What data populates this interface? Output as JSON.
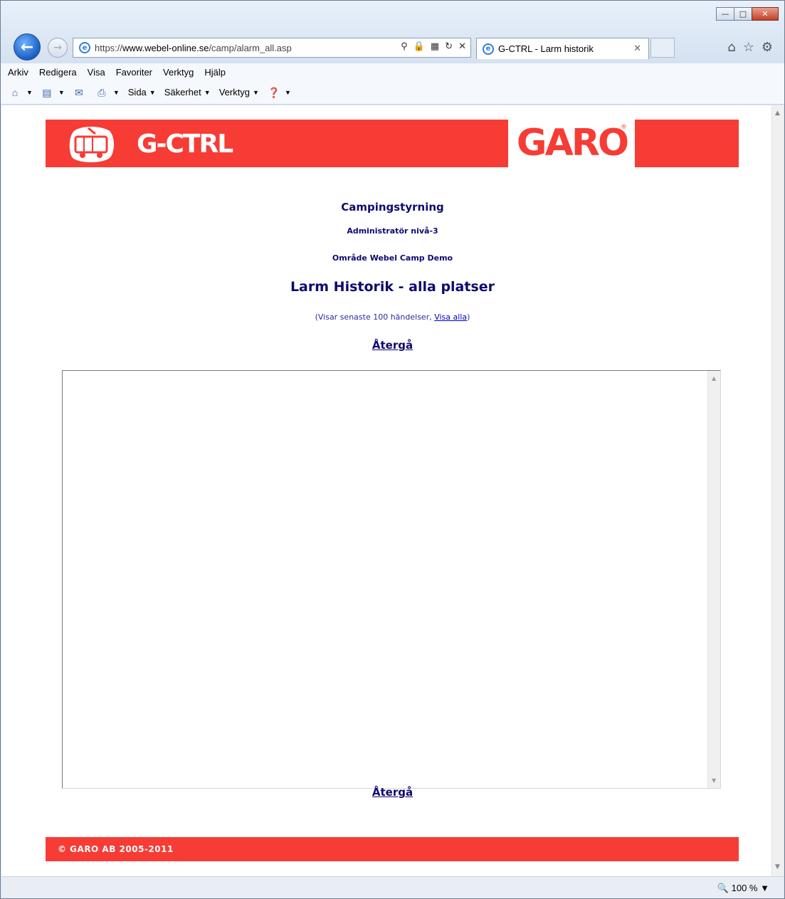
{
  "browser": {
    "url_prefix": "https://",
    "url_host": "www.webel-online.se",
    "url_path": "/camp/alarm_all.asp",
    "tab_title": "G-CTRL - Larm historik",
    "menu": [
      "Arkiv",
      "Redigera",
      "Visa",
      "Favoriter",
      "Verktyg",
      "Hjälp"
    ],
    "commands": [
      {
        "label": "Sida",
        "icon": "page-icon"
      },
      {
        "label": "Säkerhet",
        "icon": "safety-icon"
      },
      {
        "label": "Verktyg",
        "icon": "tools-icon"
      }
    ],
    "zoom": "100 %"
  },
  "banner": {
    "product": "G-CTRL",
    "brand": "GARO",
    "brand_mark": "®",
    "color": "#f63c35"
  },
  "page": {
    "title": "Campingstyrning",
    "level": "Administratör nivå-3",
    "area": "Område Webel Camp Demo",
    "heading": "Larm Historik - alla platser",
    "info_prefix": "(Visar senaste 100 händelser, ",
    "info_link": "Visa alla",
    "info_suffix": ")",
    "back_label": "Återgå",
    "footer": "© GARO AB 2005-2011"
  }
}
